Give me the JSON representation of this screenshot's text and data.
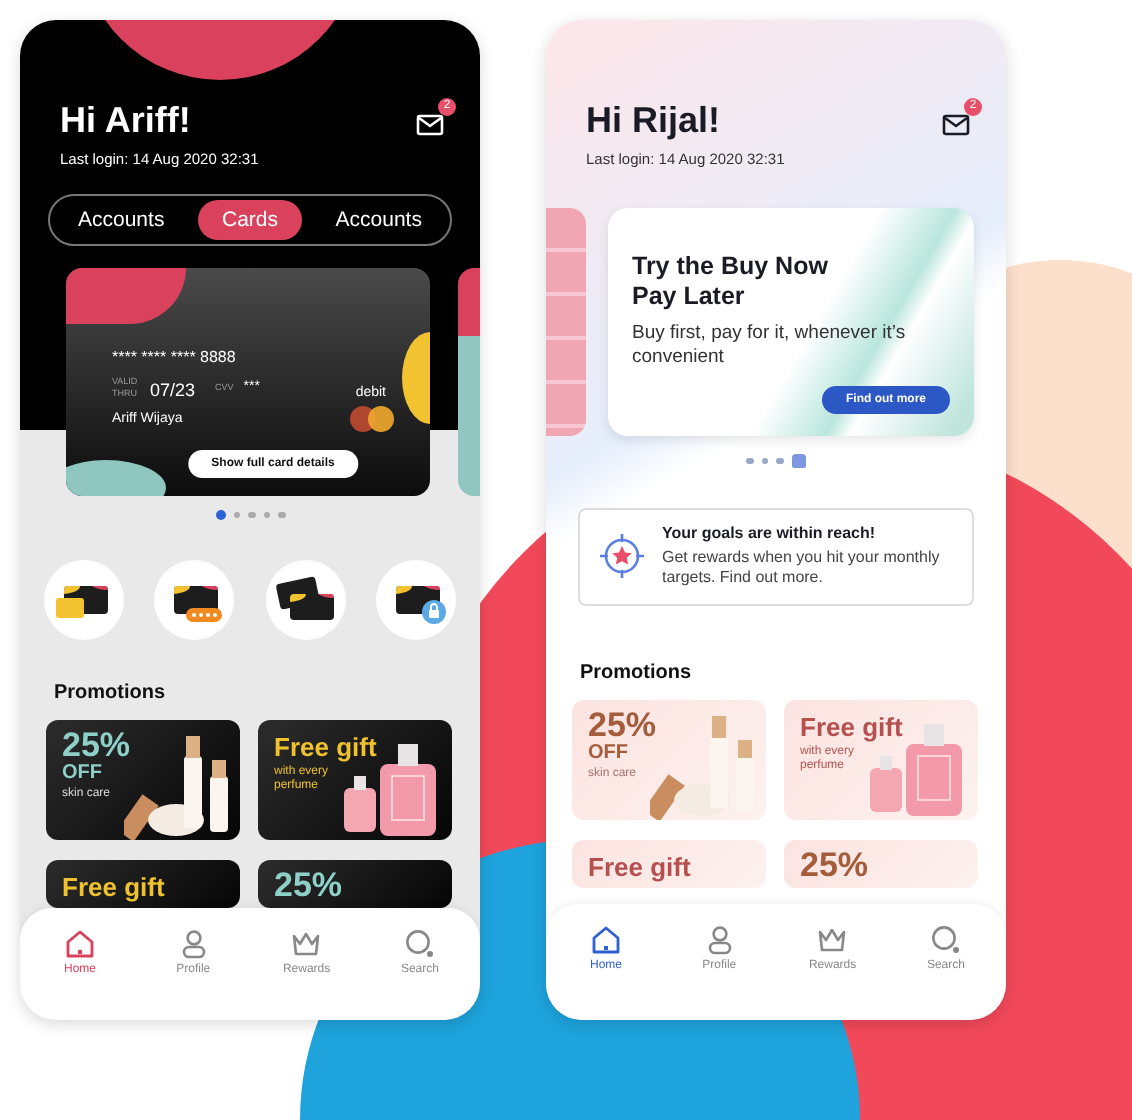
{
  "screens": [
    {
      "kind": "dark",
      "greeting": "Hi Ariff!",
      "last_login": "Last login: 14 Aug 2020 32:31",
      "badge": "2",
      "tabs": [
        {
          "label": "Accounts",
          "selected": false
        },
        {
          "label": "Cards",
          "selected": true
        },
        {
          "label": "Accounts",
          "selected": false
        }
      ],
      "card": {
        "number": "**** **** **** 8888",
        "valid_label": "VALID THRU",
        "expiry": "07/23",
        "cvv_label": "CVV",
        "cvv": "***",
        "type": "debit",
        "holder": "Ariff Wijaya",
        "button": "Show full card details"
      },
      "dots": [
        {
          "selected": true
        },
        {
          "selected": false
        },
        {
          "selected": false
        },
        {
          "selected": false
        },
        {
          "selected": false
        }
      ],
      "quick_actions": [
        {
          "kind": "card"
        },
        {
          "kind": "pin"
        },
        {
          "kind": "cards"
        },
        {
          "kind": "lock"
        }
      ],
      "promotions": {
        "title": "Promotions",
        "items": [
          {
            "kind": "discount",
            "headline": "25%",
            "sub": "OFF",
            "caption": "skin care"
          },
          {
            "kind": "gift",
            "headline": "Free gift",
            "caption": "with every perfume"
          },
          {
            "kind": "gift",
            "headline": "Free gift"
          },
          {
            "kind": "discount",
            "headline": "25%"
          }
        ]
      },
      "nav": [
        {
          "label": "Home",
          "selected": true
        },
        {
          "label": "Profile",
          "selected": false
        },
        {
          "label": "Rewards",
          "selected": false
        },
        {
          "label": "Search",
          "selected": false
        }
      ]
    },
    {
      "kind": "light",
      "greeting": "Hi Rijal!",
      "last_login": "Last login: 14 Aug 2020 32:31",
      "badge": "2",
      "banner": {
        "title": "Try the Buy Now Pay Later",
        "text": "Buy first, pay for it, whenever it’s convenient",
        "button": "Find out more"
      },
      "dots": [
        {
          "selected": false
        },
        {
          "selected": false
        },
        {
          "selected": false
        },
        {
          "selected": true
        }
      ],
      "goal": {
        "title": "Your goals are within reach!",
        "text": "Get rewards when you hit your monthly targets. Find out more."
      },
      "promotions": {
        "title": "Promotions",
        "items": [
          {
            "kind": "discount",
            "headline": "25%",
            "sub": "OFF",
            "caption": "skin care"
          },
          {
            "kind": "gift",
            "headline": "Free gift",
            "caption": "with every perfume"
          },
          {
            "kind": "gift",
            "headline": "Free gift"
          },
          {
            "kind": "discount",
            "headline": "25%"
          }
        ]
      },
      "nav": [
        {
          "label": "Home",
          "selected": true
        },
        {
          "label": "Profile",
          "selected": false
        },
        {
          "label": "Rewards",
          "selected": false
        },
        {
          "label": "Search",
          "selected": false
        }
      ]
    }
  ]
}
